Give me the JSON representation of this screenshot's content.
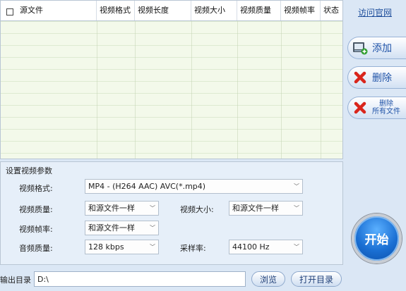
{
  "table": {
    "columns": [
      "源文件",
      "视频格式",
      "视频长度",
      "视频大小",
      "视频质量",
      "视频帧率",
      "状态"
    ],
    "rows": []
  },
  "side": {
    "visit_link": "访问官网",
    "add_label": "添加",
    "delete_label": "删除",
    "delete_all_line1": "删除",
    "delete_all_line2": "所有文件",
    "start_label": "开始"
  },
  "settings": {
    "title": "设置视频参数",
    "format_label": "视频格式:",
    "format_value": "MP4 - (H264 AAC) AVC(*.mp4)",
    "quality_label": "视频质量:",
    "quality_value": "和源文件一样",
    "size_label": "视频大小:",
    "size_value": "和源文件一样",
    "framerate_label": "视频帧率:",
    "framerate_value": "和源文件一样",
    "audio_quality_label": "音频质量:",
    "audio_quality_value": "128 kbps",
    "sample_rate_label": "采样率:",
    "sample_rate_value": "44100 Hz"
  },
  "output": {
    "label": "输出目录",
    "path": "D:\\",
    "browse_label": "浏览",
    "open_dir_label": "打开目录"
  },
  "colors": {
    "accent": "#1f53a8",
    "table_bg": "#f3f9ea",
    "panel_bg": "#e6eff9",
    "start_button": "#1a6fd3",
    "delete_red": "#d9251c"
  }
}
